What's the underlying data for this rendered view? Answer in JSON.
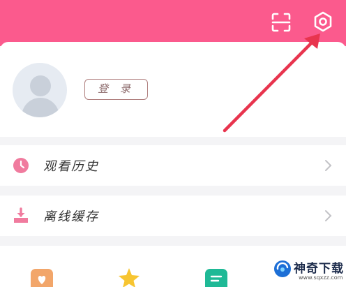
{
  "header": {
    "background": "#fb5a8d",
    "scan_icon": "scan-icon",
    "settings_icon": "gear-icon"
  },
  "profile": {
    "avatar_icon": "default-avatar-icon",
    "login_label": "登 录"
  },
  "menu": {
    "items": [
      {
        "label": "观看历史",
        "icon": "clock-icon",
        "icon_color": "#f07b9e"
      },
      {
        "label": "离线缓存",
        "icon": "download-icon",
        "icon_color": "#f07b9e"
      }
    ]
  },
  "shortcuts": {
    "items": [
      {
        "icon": "heart-icon",
        "color": "#f2a66a"
      },
      {
        "icon": "star-icon",
        "color": "#f7c531"
      },
      {
        "icon": "note-icon",
        "color": "#1fb996"
      }
    ]
  },
  "annotation": {
    "arrow_color": "#e8344e"
  },
  "watermark": {
    "title": "神奇下载",
    "url": "www.sqxzz.com"
  }
}
